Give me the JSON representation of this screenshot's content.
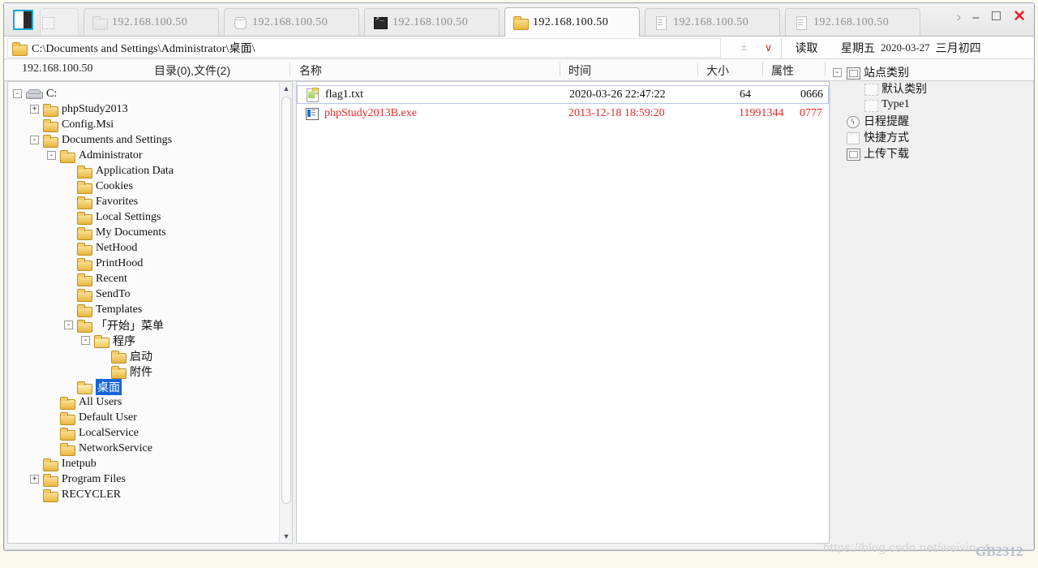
{
  "window": {
    "system_icon": "panel-toggle-icon",
    "buttons": {
      "overflow": "›",
      "minimize": "–",
      "maximize": "☐",
      "close": "✕"
    }
  },
  "tabs": [
    {
      "icon": "dashed-square-icon",
      "label": "",
      "active": false,
      "ghost": true
    },
    {
      "icon": "folder-icon",
      "label": "192.168.100.50",
      "active": false,
      "ghost": false
    },
    {
      "icon": "database-icon",
      "label": "192.168.100.50",
      "active": false,
      "ghost": false
    },
    {
      "icon": "terminal-icon",
      "label": "192.168.100.50",
      "active": false,
      "ghost": false
    },
    {
      "icon": "folder-icon",
      "label": "192.168.100.50",
      "active": true,
      "ghost": false
    },
    {
      "icon": "document-icon",
      "label": "192.168.100.50",
      "active": false,
      "ghost": false
    },
    {
      "icon": "document-icon",
      "label": "192.168.100.50",
      "active": false,
      "ghost": false
    }
  ],
  "address": {
    "icon": "folder-icon",
    "path": "C:\\Documents and Settings\\Administrator\\桌面\\",
    "plusminus": "±",
    "chevron": "∨",
    "read_button": "读取"
  },
  "datebar": {
    "weekday": "星期五",
    "date": "2020-03-27",
    "lunar": "三月初四"
  },
  "statusstrip": {
    "host": "192.168.100.50",
    "counts": "目录(0),文件(2)"
  },
  "columns": {
    "name": "名称",
    "time": "时间",
    "size": "大小",
    "attr": "属性"
  },
  "tree": {
    "nodes": [
      {
        "depth": 0,
        "toggle": "-",
        "icon": "drive-icon",
        "label": "C:",
        "selected": false,
        "cjk": false
      },
      {
        "depth": 1,
        "toggle": "+",
        "icon": "folder-icon",
        "label": "phpStudy2013",
        "selected": false,
        "cjk": false
      },
      {
        "depth": 1,
        "toggle": "",
        "icon": "folder-icon",
        "label": "Config.Msi",
        "selected": false,
        "cjk": false
      },
      {
        "depth": 1,
        "toggle": "-",
        "icon": "folder-icon",
        "label": "Documents and Settings",
        "selected": false,
        "cjk": false
      },
      {
        "depth": 2,
        "toggle": "-",
        "icon": "folder-icon",
        "label": "Administrator",
        "selected": false,
        "cjk": false
      },
      {
        "depth": 3,
        "toggle": "",
        "icon": "folder-icon",
        "label": "Application Data",
        "selected": false,
        "cjk": false
      },
      {
        "depth": 3,
        "toggle": "",
        "icon": "folder-icon",
        "label": "Cookies",
        "selected": false,
        "cjk": false
      },
      {
        "depth": 3,
        "toggle": "",
        "icon": "folder-icon",
        "label": "Favorites",
        "selected": false,
        "cjk": false
      },
      {
        "depth": 3,
        "toggle": "",
        "icon": "folder-icon",
        "label": "Local Settings",
        "selected": false,
        "cjk": false
      },
      {
        "depth": 3,
        "toggle": "",
        "icon": "folder-icon",
        "label": "My Documents",
        "selected": false,
        "cjk": false
      },
      {
        "depth": 3,
        "toggle": "",
        "icon": "folder-icon",
        "label": "NetHood",
        "selected": false,
        "cjk": false
      },
      {
        "depth": 3,
        "toggle": "",
        "icon": "folder-icon",
        "label": "PrintHood",
        "selected": false,
        "cjk": false
      },
      {
        "depth": 3,
        "toggle": "",
        "icon": "folder-icon",
        "label": "Recent",
        "selected": false,
        "cjk": false
      },
      {
        "depth": 3,
        "toggle": "",
        "icon": "folder-icon",
        "label": "SendTo",
        "selected": false,
        "cjk": false
      },
      {
        "depth": 3,
        "toggle": "",
        "icon": "folder-icon",
        "label": "Templates",
        "selected": false,
        "cjk": false
      },
      {
        "depth": 3,
        "toggle": "-",
        "icon": "folder-icon",
        "label": "「开始」菜单",
        "selected": false,
        "cjk": true
      },
      {
        "depth": 4,
        "toggle": "-",
        "icon": "folder-open-icon",
        "label": "程序",
        "selected": false,
        "cjk": true
      },
      {
        "depth": 5,
        "toggle": "",
        "icon": "folder-icon",
        "label": "启动",
        "selected": false,
        "cjk": true
      },
      {
        "depth": 5,
        "toggle": "",
        "icon": "folder-icon",
        "label": "附件",
        "selected": false,
        "cjk": true
      },
      {
        "depth": 3,
        "toggle": "",
        "icon": "folder-open-icon",
        "label": "桌面",
        "selected": true,
        "cjk": true
      },
      {
        "depth": 2,
        "toggle": "",
        "icon": "folder-icon",
        "label": "All Users",
        "selected": false,
        "cjk": false
      },
      {
        "depth": 2,
        "toggle": "",
        "icon": "folder-icon",
        "label": "Default User",
        "selected": false,
        "cjk": false
      },
      {
        "depth": 2,
        "toggle": "",
        "icon": "folder-icon",
        "label": "LocalService",
        "selected": false,
        "cjk": false
      },
      {
        "depth": 2,
        "toggle": "",
        "icon": "folder-icon",
        "label": "NetworkService",
        "selected": false,
        "cjk": false
      },
      {
        "depth": 1,
        "toggle": "",
        "icon": "folder-icon",
        "label": "Inetpub",
        "selected": false,
        "cjk": false
      },
      {
        "depth": 1,
        "toggle": "+",
        "icon": "folder-icon",
        "label": "Program Files",
        "selected": false,
        "cjk": false
      },
      {
        "depth": 1,
        "toggle": "",
        "icon": "folder-icon",
        "label": "RECYCLER",
        "selected": false,
        "cjk": false
      }
    ],
    "scroll": {
      "up_arrow": "▲",
      "down_arrow": "▼"
    }
  },
  "files": [
    {
      "icon": "text-file-icon",
      "name": "flag1.txt",
      "time": "2020-03-26 22:47:22",
      "size": "64",
      "attr": "0666",
      "red": false,
      "selected": true
    },
    {
      "icon": "executable-icon",
      "name": "phpStudy2013B.exe",
      "time": "2013-12-18 18:59:20",
      "size": "11991344",
      "attr": "0777",
      "red": true,
      "selected": false
    }
  ],
  "sitetree": [
    {
      "depth": 0,
      "toggle": "-",
      "icon": "window-icon",
      "label": "站点类别",
      "dim": false,
      "mono": false
    },
    {
      "depth": 1,
      "toggle": "",
      "icon": "dashed-icon",
      "label": "默认类别",
      "dim": false,
      "mono": false
    },
    {
      "depth": 1,
      "toggle": "",
      "icon": "dashed-icon",
      "label": "Type1",
      "dim": false,
      "mono": true
    },
    {
      "depth": 0,
      "toggle": "",
      "icon": "clock-icon",
      "label": "日程提醒",
      "dim": false,
      "mono": false
    },
    {
      "depth": 0,
      "toggle": "",
      "icon": "hand-icon",
      "label": "快捷方式",
      "dim": false,
      "mono": false
    },
    {
      "depth": 0,
      "toggle": "",
      "icon": "window-icon",
      "label": "上传下载",
      "dim": false,
      "mono": false
    }
  ],
  "watermark": {
    "url": "https://blog.csdn.net/weixin_4",
    "badge": "GB2312"
  }
}
